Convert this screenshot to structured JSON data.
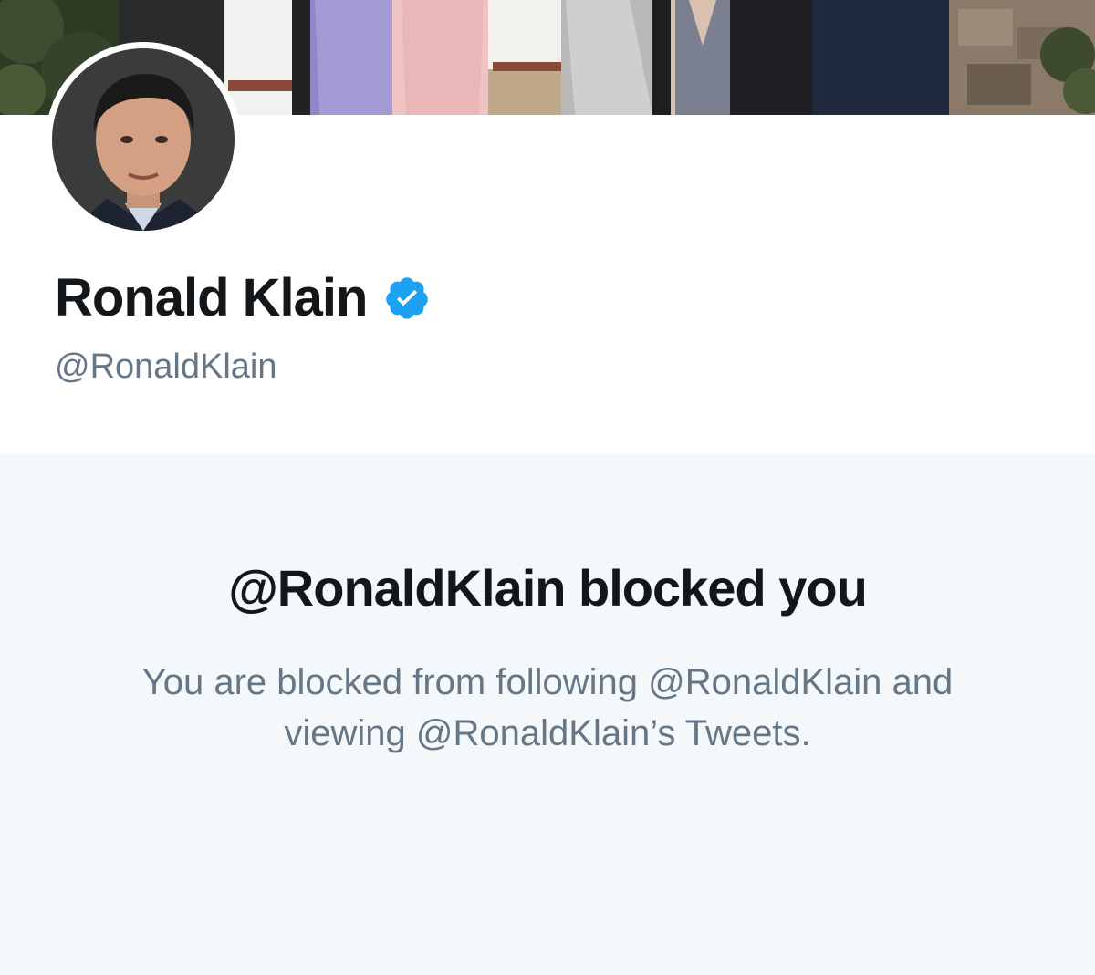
{
  "profile": {
    "display_name": "Ronald Klain",
    "handle": "@RonaldKlain",
    "verified": true
  },
  "blocked": {
    "title": "@RonaldKlain blocked you",
    "message": "You are blocked from following @RonaldKlain and viewing @RonaldKlain’s Tweets."
  },
  "colors": {
    "text_primary": "#14171a",
    "text_secondary": "#657786",
    "verified_blue": "#1da1f2",
    "blocked_bg": "#f5f8fa"
  },
  "icons": {
    "verified": "verified-badge-icon"
  }
}
